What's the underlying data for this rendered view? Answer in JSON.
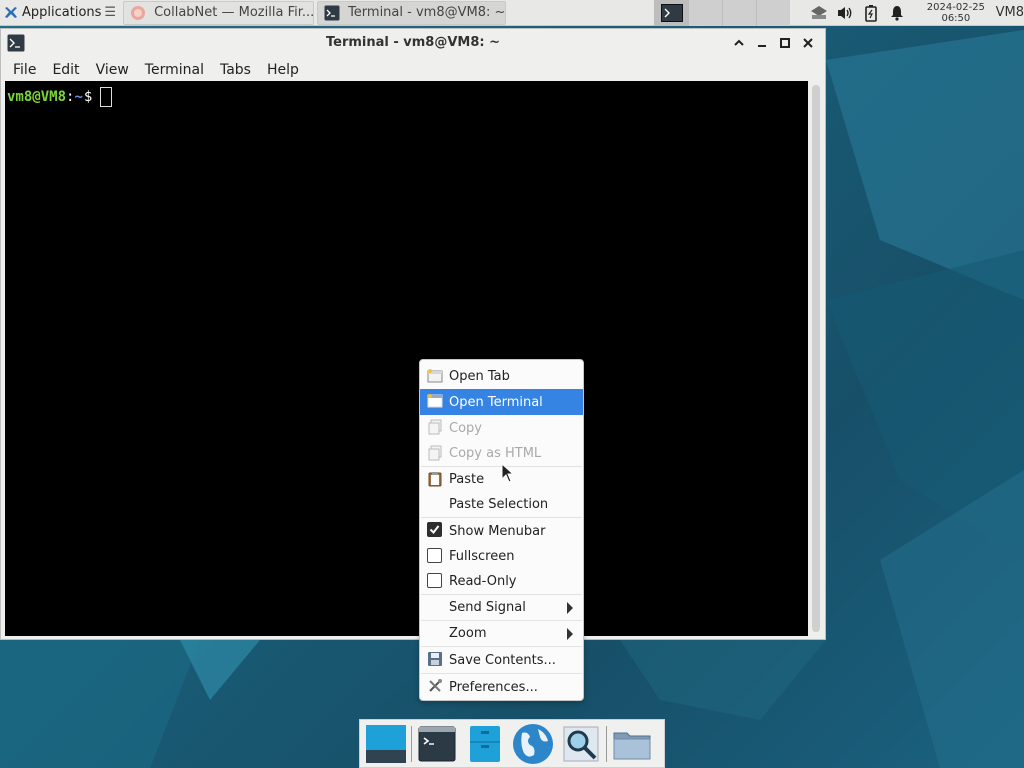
{
  "top_panel": {
    "applications_label": "Applications",
    "tasks": [
      {
        "label": "CollabNet — Mozilla Fir...",
        "icon": "firefox-icon"
      },
      {
        "label": "Terminal - vm8@VM8: ~",
        "icon": "terminal-icon"
      }
    ],
    "clock_date": "2024-02-25",
    "clock_time": "06:50",
    "user": "VM8",
    "tray_icons": [
      "network-icon",
      "volume-icon",
      "battery-icon",
      "notification-bell-icon"
    ]
  },
  "window": {
    "title": "Terminal - vm8@VM8: ~",
    "menu": [
      "File",
      "Edit",
      "View",
      "Terminal",
      "Tabs",
      "Help"
    ]
  },
  "terminal": {
    "user_host": "vm8@VM8",
    "sep": ":",
    "path": "~",
    "dollar": "$"
  },
  "context_menu": {
    "items": [
      {
        "label": "Open Tab",
        "icon": "new-tab-icon",
        "state": "normal"
      },
      {
        "label": "Open Terminal",
        "icon": "new-window-icon",
        "state": "highlighted"
      },
      {
        "label": "Copy",
        "icon": "copy-icon",
        "state": "disabled"
      },
      {
        "label": "Copy as HTML",
        "icon": "copy-icon",
        "state": "disabled"
      },
      {
        "label": "Paste",
        "icon": "paste-icon",
        "state": "normal"
      },
      {
        "label": "Paste Selection",
        "state": "normal"
      },
      {
        "label": "Show Menubar",
        "checked": true
      },
      {
        "label": "Fullscreen",
        "checked": false
      },
      {
        "label": "Read-Only",
        "checked": false
      },
      {
        "label": "Send Signal",
        "submenu": true
      },
      {
        "label": "Zoom",
        "submenu": true
      },
      {
        "label": "Save Contents...",
        "icon": "save-icon"
      },
      {
        "label": "Preferences...",
        "icon": "preferences-icon"
      }
    ]
  },
  "dock": {
    "items": [
      "show-desktop-icon",
      "terminal-icon",
      "file-manager-icon",
      "web-browser-icon",
      "app-finder-icon",
      "folder-icon"
    ]
  }
}
